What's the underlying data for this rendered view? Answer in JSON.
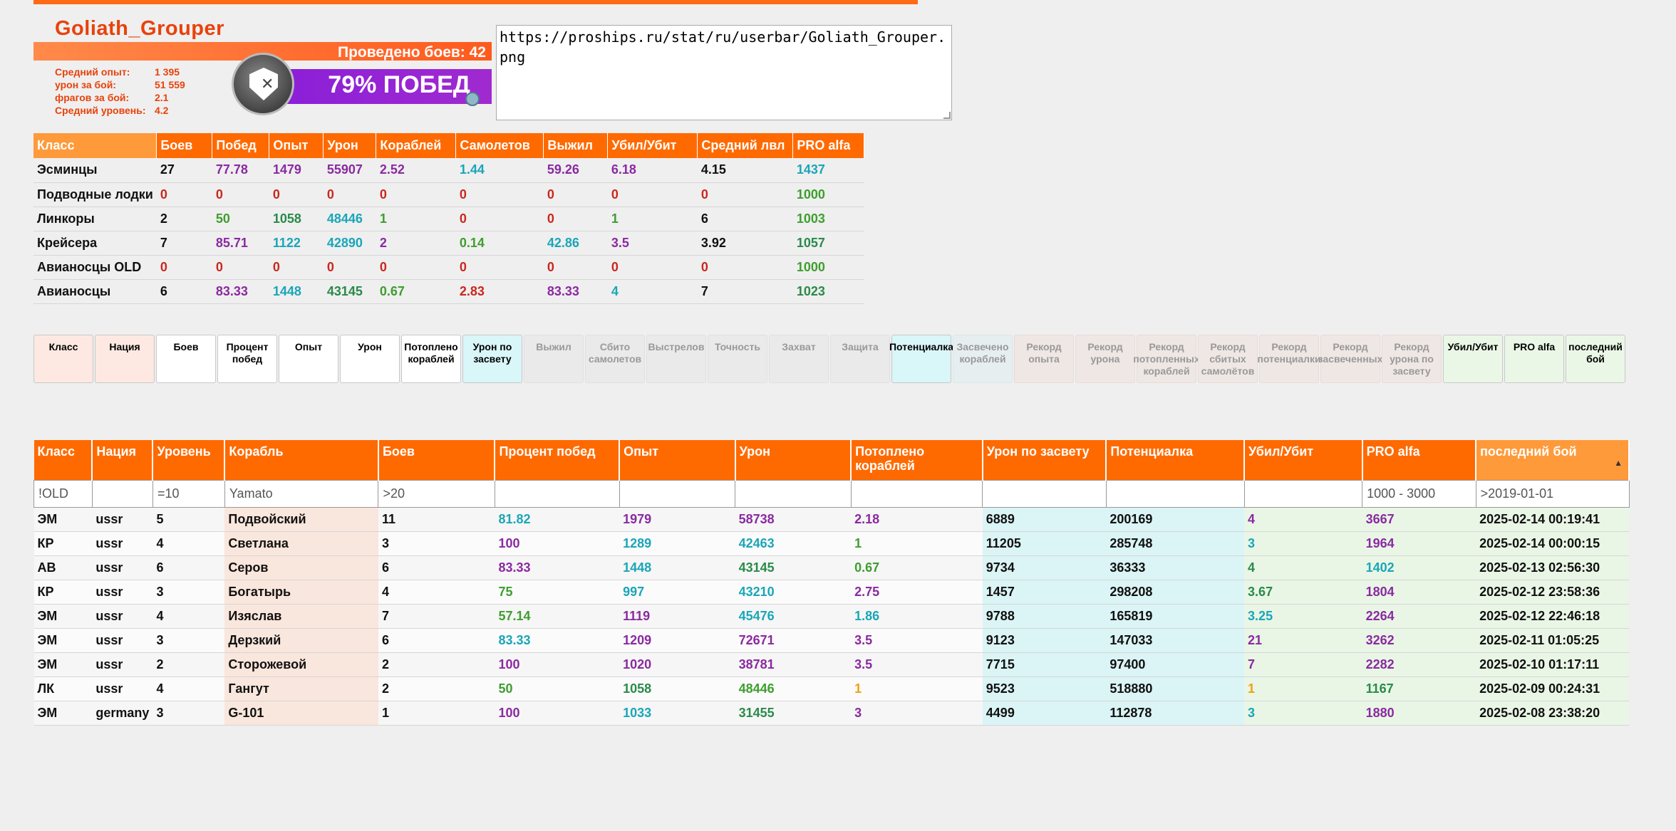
{
  "userbar": {
    "name": "Goliath_Grouper",
    "battles": "Проведено боев: 42",
    "winrate": "79% ПОБЕД",
    "stats": [
      {
        "k": "Средний опыт:",
        "v": "1 395"
      },
      {
        "k": "урон за бой:",
        "v": "51 559"
      },
      {
        "k": "фрагов за бой:",
        "v": "2.1"
      },
      {
        "k": "Средний уровень:",
        "v": "4.2"
      }
    ],
    "url": "https://proships.ru/stat/ru/userbar/Goliath_Grouper.png"
  },
  "class_table": {
    "headers": [
      "Класс",
      "Боев",
      "Побед",
      "Опыт",
      "Урон",
      "Кораблей",
      "Самолетов",
      "Выжил",
      "Убил/Убит",
      "Средний лвл",
      "PRO alfa"
    ],
    "rows": [
      [
        "Эсминцы",
        "27",
        "77.78",
        "1479",
        "55907",
        "2.52",
        "1.44",
        "59.26",
        "6.18",
        "4.15",
        "1437"
      ],
      [
        "Подводные лодки",
        "0",
        "0",
        "0",
        "0",
        "0",
        "0",
        "0",
        "0",
        "0",
        "1000"
      ],
      [
        "Линкоры",
        "2",
        "50",
        "1058",
        "48446",
        "1",
        "0",
        "0",
        "1",
        "6",
        "1003"
      ],
      [
        "Крейсера",
        "7",
        "85.71",
        "1122",
        "42890",
        "2",
        "0.14",
        "42.86",
        "3.5",
        "3.92",
        "1057"
      ],
      [
        "Авианосцы OLD",
        "0",
        "0",
        "0",
        "0",
        "0",
        "0",
        "0",
        "0",
        "0",
        "1000"
      ],
      [
        "Авианосцы",
        "6",
        "83.33",
        "1448",
        "43145",
        "0.67",
        "2.83",
        "83.33",
        "4",
        "7",
        "1023"
      ]
    ],
    "colors": [
      [
        "dark",
        "dark",
        "purple",
        "purple",
        "purple",
        "purple",
        "teal",
        "purple",
        "purple",
        "dark",
        "teal"
      ],
      [
        "dark",
        "red",
        "red",
        "red",
        "red",
        "red",
        "red",
        "red",
        "red",
        "red",
        "green"
      ],
      [
        "dark",
        "dark",
        "green",
        "dgreen",
        "teal",
        "green",
        "red",
        "red",
        "green",
        "dark",
        "green"
      ],
      [
        "dark",
        "dark",
        "purple",
        "teal",
        "teal",
        "purple",
        "green",
        "teal",
        "purple",
        "dark",
        "dgreen"
      ],
      [
        "dark",
        "red",
        "red",
        "red",
        "red",
        "red",
        "red",
        "red",
        "red",
        "red",
        "green"
      ],
      [
        "dark",
        "dark",
        "purple",
        "teal",
        "dgreen",
        "green",
        "red",
        "purple",
        "teal",
        "dark",
        "dgreen"
      ]
    ]
  },
  "toggles": [
    {
      "label": "Класс",
      "style": "on-pink"
    },
    {
      "label": "Нация",
      "style": "on-pink"
    },
    {
      "label": "Боев",
      "style": "on-white"
    },
    {
      "label": "Процент побед",
      "style": "on-white"
    },
    {
      "label": "Опыт",
      "style": "on-white"
    },
    {
      "label": "Урон",
      "style": "on-white"
    },
    {
      "label": "Потоплено кораблей",
      "style": "on-white"
    },
    {
      "label": "Урон по засвету",
      "style": "on-cyan"
    },
    {
      "label": "Выжил",
      "style": "off"
    },
    {
      "label": "Сбито самолетов",
      "style": "off"
    },
    {
      "label": "Выстрелов",
      "style": "off"
    },
    {
      "label": "Точность",
      "style": "off"
    },
    {
      "label": "Захват",
      "style": "off"
    },
    {
      "label": "Защита",
      "style": "off"
    },
    {
      "label": "Потенциалка",
      "style": "on-cyan"
    },
    {
      "label": "Засвечено кораблей",
      "style": "off-cyan"
    },
    {
      "label": "Рекорд опыта",
      "style": "off-pink"
    },
    {
      "label": "Рекорд урона",
      "style": "off-pink"
    },
    {
      "label": "Рекорд потопленных кораблей",
      "style": "off-pink"
    },
    {
      "label": "Рекорд сбитых самолётов",
      "style": "off-pink"
    },
    {
      "label": "Рекорд потенциалки",
      "style": "off-pink"
    },
    {
      "label": "Рекорд засвеченных",
      "style": "off-pink"
    },
    {
      "label": "Рекорд урона по засвету",
      "style": "off-pink"
    },
    {
      "label": "Убил/Убит",
      "style": "on-green"
    },
    {
      "label": "PRO alfa",
      "style": "on-green"
    },
    {
      "label": "последний бой",
      "style": "on-green"
    }
  ],
  "main_table": {
    "headers": [
      "Класс",
      "Нация",
      "Уровень",
      "Корабль",
      "Боев",
      "Процент побед",
      "Опыт",
      "Урон",
      "Потоплено кораблей",
      "Урон по засвету",
      "Потенциалка",
      "Убил/Убит",
      "PRO alfa",
      "последний бой"
    ],
    "filters": [
      "!OLD",
      "",
      "=10",
      "Yamato",
      ">20",
      "",
      "",
      "",
      "",
      "",
      "",
      "",
      "1000 - 3000",
      ">2019-01-01"
    ],
    "rows": [
      [
        "ЭМ",
        "ussr",
        "5",
        "Подвойский",
        "11",
        "81.82",
        "1979",
        "58738",
        "2.18",
        "6889",
        "200169",
        "4",
        "3667",
        "2025-02-14 00:19:41"
      ],
      [
        "КР",
        "ussr",
        "4",
        "Светлана",
        "3",
        "100",
        "1289",
        "42463",
        "1",
        "11205",
        "285748",
        "3",
        "1964",
        "2025-02-14 00:00:15"
      ],
      [
        "АВ",
        "ussr",
        "6",
        "Серов",
        "6",
        "83.33",
        "1448",
        "43145",
        "0.67",
        "9734",
        "36333",
        "4",
        "1402",
        "2025-02-13 02:56:30"
      ],
      [
        "КР",
        "ussr",
        "3",
        "Богатырь",
        "4",
        "75",
        "997",
        "43210",
        "2.75",
        "1457",
        "298208",
        "3.67",
        "1804",
        "2025-02-12 23:58:36"
      ],
      [
        "ЭМ",
        "ussr",
        "4",
        "Изяслав",
        "7",
        "57.14",
        "1119",
        "45476",
        "1.86",
        "9788",
        "165819",
        "3.25",
        "2264",
        "2025-02-12 22:46:18"
      ],
      [
        "ЭМ",
        "ussr",
        "3",
        "Дерзкий",
        "6",
        "83.33",
        "1209",
        "72671",
        "3.5",
        "9123",
        "147033",
        "21",
        "3262",
        "2025-02-11 01:05:25"
      ],
      [
        "ЭМ",
        "ussr",
        "2",
        "Сторожевой",
        "2",
        "100",
        "1020",
        "38781",
        "3.5",
        "7715",
        "97400",
        "7",
        "2282",
        "2025-02-10 01:17:11"
      ],
      [
        "ЛК",
        "ussr",
        "4",
        "Гангут",
        "2",
        "50",
        "1058",
        "48446",
        "1",
        "9523",
        "518880",
        "1",
        "1167",
        "2025-02-09 00:24:31"
      ],
      [
        "ЭМ",
        "germany",
        "3",
        "G-101",
        "1",
        "100",
        "1033",
        "31455",
        "3",
        "4499",
        "112878",
        "3",
        "1880",
        "2025-02-08 23:38:20"
      ]
    ],
    "colors": [
      [
        "dark",
        "dark",
        "dark",
        "dark",
        "dark",
        "teal",
        "purple",
        "purple",
        "purple",
        "dark",
        "dark",
        "purple",
        "purple",
        "dark"
      ],
      [
        "dark",
        "dark",
        "dark",
        "dark",
        "dark",
        "purple",
        "teal",
        "teal",
        "green",
        "dark",
        "dark",
        "teal",
        "purple",
        "dark"
      ],
      [
        "dark",
        "dark",
        "dark",
        "dark",
        "dark",
        "purple",
        "teal",
        "dgreen",
        "green",
        "dark",
        "dark",
        "dgreen",
        "teal",
        "dark"
      ],
      [
        "dark",
        "dark",
        "dark",
        "dark",
        "dark",
        "green",
        "teal",
        "teal",
        "purple",
        "dark",
        "dark",
        "dgreen",
        "purple",
        "dark"
      ],
      [
        "dark",
        "dark",
        "dark",
        "dark",
        "dark",
        "green",
        "purple",
        "teal",
        "teal",
        "dark",
        "dark",
        "teal",
        "purple",
        "dark"
      ],
      [
        "dark",
        "dark",
        "dark",
        "dark",
        "dark",
        "teal",
        "purple",
        "purple",
        "purple",
        "dark",
        "dark",
        "purple",
        "purple",
        "dark"
      ],
      [
        "dark",
        "dark",
        "dark",
        "dark",
        "dark",
        "purple",
        "purple",
        "purple",
        "purple",
        "dark",
        "dark",
        "purple",
        "purple",
        "dark"
      ],
      [
        "dark",
        "dark",
        "dark",
        "dark",
        "dark",
        "green",
        "dgreen",
        "green",
        "orange",
        "dark",
        "dark",
        "orange",
        "dgreen",
        "dark"
      ],
      [
        "dark",
        "dark",
        "dark",
        "dark",
        "dark",
        "purple",
        "teal",
        "dgreen",
        "purple",
        "dark",
        "dark",
        "teal",
        "purple",
        "dark"
      ]
    ]
  }
}
